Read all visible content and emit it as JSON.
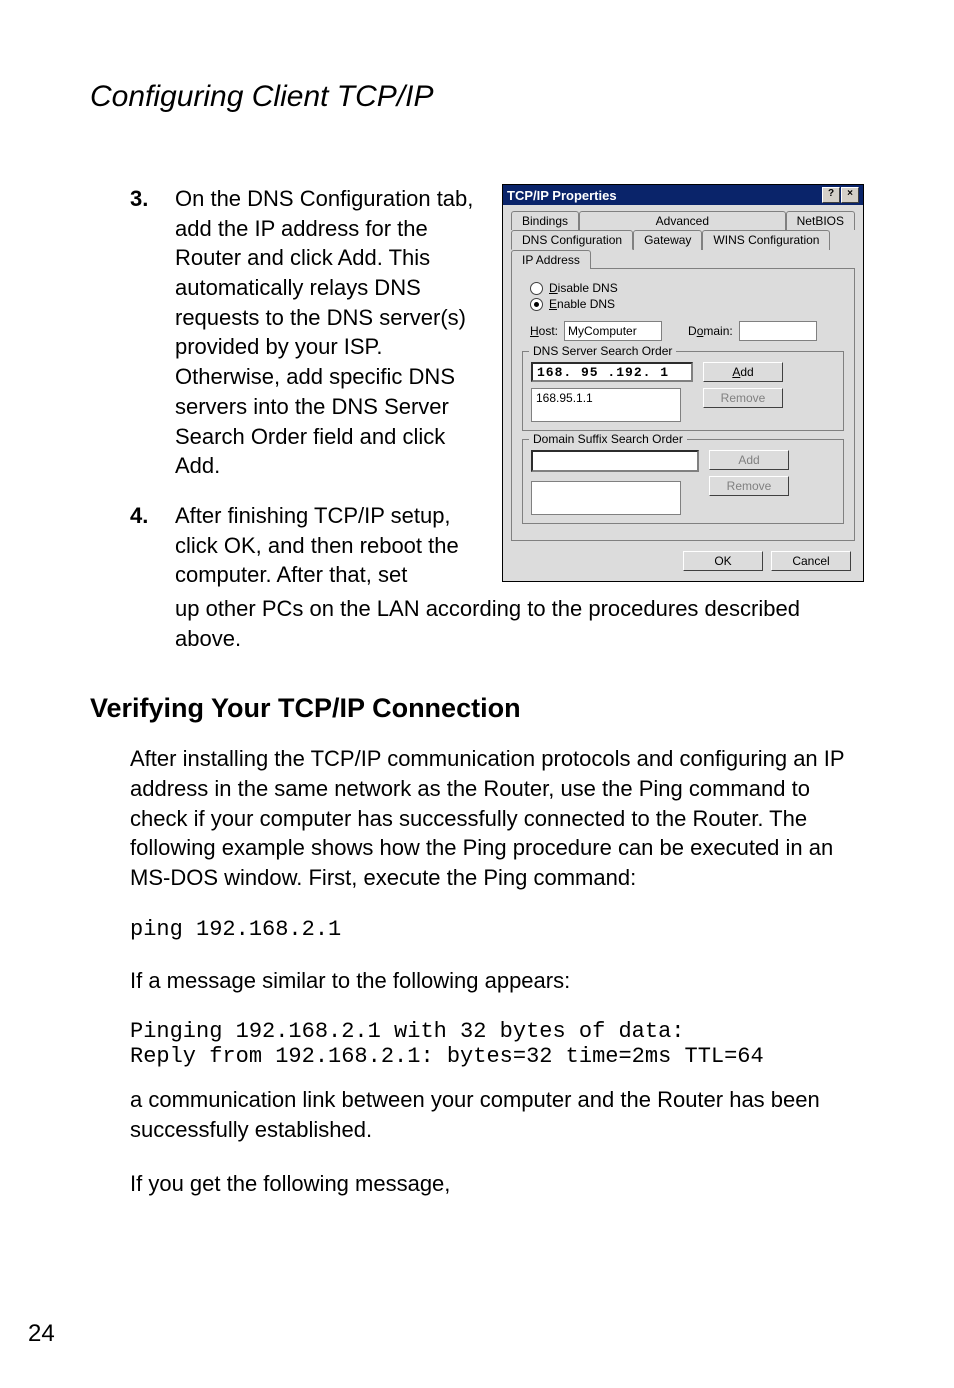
{
  "page": {
    "heading": "Configuring Client TCP/IP",
    "number": "24"
  },
  "steps": {
    "s3": {
      "num": "3.",
      "text": "On the DNS Configuration tab, add the IP address for the Router and click Add. This automatically relays DNS requests to the DNS server(s) provided by your ISP. Otherwise, add specific DNS servers into the DNS Server Search Order field and click Add."
    },
    "s4": {
      "num": "4.",
      "text_a": "After finishing TCP/IP setup, click OK, and then reboot the computer. After that, set",
      "text_b": "up other PCs on the LAN according to the procedures described above."
    }
  },
  "section": {
    "verify_heading": "Verifying Your TCP/IP Connection",
    "para1": "After installing the TCP/IP communication protocols and configuring an IP address in the same network as the Router, use the Ping command to check if your computer has successfully connected to the Router. The following example shows how the Ping procedure can be executed in an MS-DOS window. First, execute the Ping command:",
    "cmd1": "ping 192.168.2.1",
    "para2": "If a message similar to the following appears:",
    "cmd2": "Pinging 192.168.2.1 with 32 bytes of data:\nReply from 192.168.2.1: bytes=32 time=2ms TTL=64",
    "para3": "a communication link between your computer and the Router has been successfully established.",
    "para4": "If you get the following message,"
  },
  "dialog": {
    "title": "TCP/IP Properties",
    "help_glyph": "?",
    "close_glyph": "×",
    "tabs_row1": [
      "Bindings",
      "Advanced",
      "NetBIOS"
    ],
    "tabs_row2": [
      "DNS Configuration",
      "Gateway",
      "WINS Configuration",
      "IP Address"
    ],
    "radio_disable": "Disable DNS",
    "radio_enable": "Enable DNS",
    "host_label": "Host:",
    "host_value": "MyComputer",
    "domain_label": "Domain:",
    "domain_value": "",
    "dns_order_label": "DNS Server Search Order",
    "dns_input": "168. 95 .192.  1",
    "dns_list_item": "168.95.1.1",
    "domain_suffix_label": "Domain Suffix Search Order",
    "suffix_input": "",
    "btn_add": "Add",
    "btn_remove": "Remove",
    "btn_ok": "OK",
    "btn_cancel": "Cancel"
  }
}
